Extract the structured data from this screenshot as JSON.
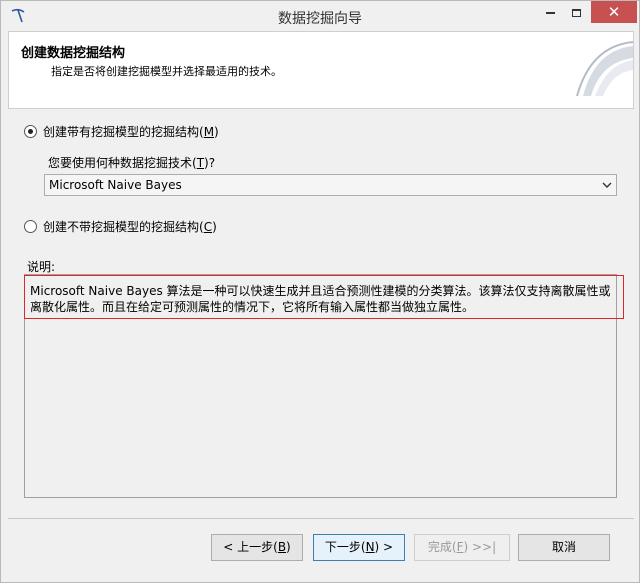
{
  "window": {
    "title": "数据挖掘向导",
    "close_glyph": "✕"
  },
  "header": {
    "title": "创建数据挖掘结构",
    "subtitle": "指定是否将创建挖掘模型并选择最适用的技术。"
  },
  "options": {
    "with_model": {
      "pre": "创建带有挖掘模型的挖掘结构(",
      "key": "M",
      "post": ")",
      "checked": true
    },
    "question": {
      "pre": "您要使用何种数据挖掘技术(",
      "key": "T",
      "post": ")?"
    },
    "technique_selected": "Microsoft Naive Bayes",
    "without_model": {
      "pre": "创建不带挖掘模型的挖掘结构(",
      "key": "C",
      "post": ")",
      "checked": false
    }
  },
  "description": {
    "label": "说明:",
    "line1": "Microsoft Naive Bayes 算法是一种可以快速生成并且适合预测性建模的分类算法。该算法仅支持离散属性或",
    "line2": "离散化属性。而且在给定可预测属性的情况下，它将所有输入属性都当做独立属性。"
  },
  "buttons": {
    "back": {
      "pre": "< 上一步(",
      "key": "B",
      "post": ")"
    },
    "next": {
      "pre": "下一步(",
      "key": "N",
      "post": ") >"
    },
    "finish": {
      "pre": "完成(",
      "key": "F",
      "post": ") >>|"
    },
    "cancel": "取消"
  },
  "colors": {
    "highlight_border": "#e0262a",
    "close_button": "#c75050"
  }
}
